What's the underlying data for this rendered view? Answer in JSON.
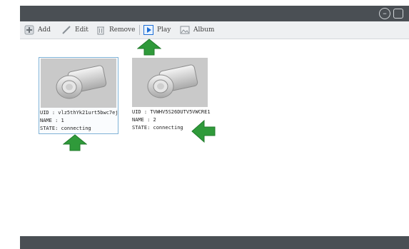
{
  "toolbar": {
    "add_label": "Add",
    "edit_label": "Edit",
    "remove_label": "Remove",
    "play_label": "Play",
    "album_label": "Album"
  },
  "window_controls": {
    "minimize_glyph": "–",
    "maximize_glyph": "□"
  },
  "devices": [
    {
      "uid": "UID : vlz5thYk21urt5bwc7ej",
      "name": "NAME : 1",
      "state": "STATE: connecting"
    },
    {
      "uid": "UID : TVWHV5S26DUTV5VWCRE1",
      "name": "NAME : 2",
      "state": "STATE: connecting"
    }
  ],
  "colors": {
    "bar": "#4a4f54",
    "arrow": "#2f9a3a",
    "accent": "#1d6ed6"
  },
  "icons": [
    "plus-icon",
    "pencil-icon",
    "trash-icon",
    "play-icon",
    "image-icon",
    "camera-icon",
    "arrow-icon"
  ]
}
